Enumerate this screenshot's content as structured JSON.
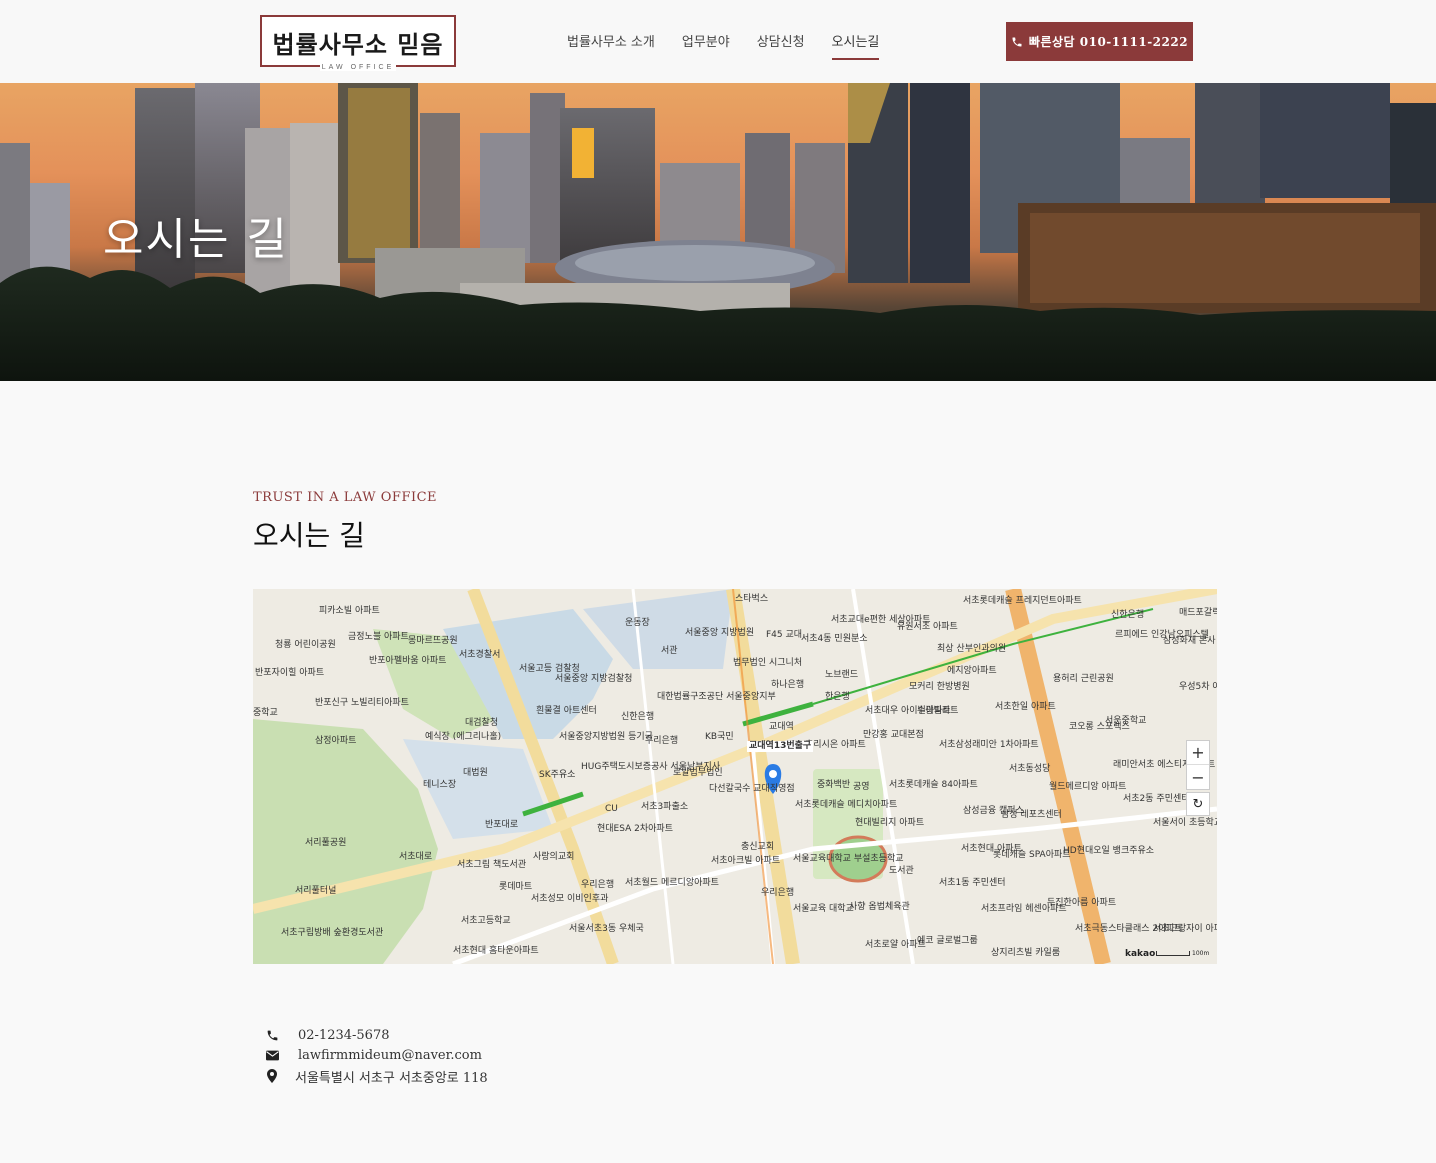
{
  "header": {
    "logo": {
      "title": "법률사무소 믿음",
      "subtitle": "LAW OFFICE"
    },
    "nav": [
      {
        "label": "법률사무소 소개"
      },
      {
        "label": "업무분야"
      },
      {
        "label": "상담신청"
      },
      {
        "label": "오시는길",
        "active": true
      }
    ],
    "cta_label": "빠른상담 010-1111-2222",
    "accent_color": "#8b3a3a"
  },
  "hero": {
    "title": "오시는 길"
  },
  "section": {
    "eyebrow": "TRUST IN A LAW OFFICE",
    "title": "오시는 길"
  },
  "map": {
    "provider": "kakao",
    "scale_label": "100m",
    "center_label": "교대역13번출구",
    "labels": [
      "피카소빌 아파트",
      "금정노블 아파트",
      "몽마르뜨공원",
      "서초경찰서",
      "운동장",
      "서울중앙 지방법원",
      "서관",
      "F45 교대",
      "서초4동 민원분소",
      "서초교대e편한 세상아파트",
      "유원서초 아파트",
      "서초롯데캐슬 프레지던트아파트",
      "신한은행",
      "르피에드 인강남오피스텔",
      "삼성화재 본사",
      "청룡 어린이공원",
      "반포아펠바움 아파트",
      "서울고등 검찰청",
      "서울중앙 지방검찰청",
      "법무법인 시그니처",
      "노브랜드",
      "최상 산부인과의원",
      "에지앙아파트",
      "용허리 근린공원",
      "우성5차 아파트",
      "반포자이힐 아파트",
      "하나은행",
      "한은행",
      "모커리 한방병원",
      "서초한일 아파트",
      "반포신구 노빌리티아파트",
      "대한법률구조공단 서울중앙지부",
      "흰물결 아트센터",
      "신한은행",
      "서초대우 아이빌아파트",
      "수광빌라트",
      "코오롱 스포렉스",
      "서운중학교",
      "중학교",
      "삼정아파트",
      "대검찰청",
      "예식장 (에그리나홀)",
      "서울중앙지방법원 등기국",
      "우리은행",
      "KB국민",
      "교대역",
      "초리시온 아파트",
      "만강홍 교대본점",
      "서초삼성래미안 1차아파트",
      "래미안서초 에스티지아파트",
      "테니스장",
      "대법원",
      "HUG주택도시보증공사 서울남부지사",
      "SK주유소",
      "로얄법무법인",
      "공영",
      "중화백반",
      "서초롯데캐슬 84아파트",
      "서초동성당",
      "월드메르디앙 아파트",
      "서초2동 주민센터",
      "다선칼국수 교대직영점",
      "CU",
      "서초3파출소",
      "서초롯데캐슬 메디치아파트",
      "삼성금융 캠퍼스",
      "삼성 레포츠센터",
      "서울서이 초등학교",
      "서리풀공원",
      "현대ESA 2차아파트",
      "현대빌리지 아파트",
      "사랑의교회",
      "충신교회",
      "서울교육대학교 부설초등학교",
      "도서관",
      "서초현대 아파트",
      "롯데캐슬 SPA아파트",
      "HD현대오일 뱅크주유소",
      "서초그림 책도서관",
      "서초아크빌 아파트",
      "롯데마트",
      "우리은행",
      "서초월드 메르디앙아파트",
      "서초1동 주민센터",
      "서초성모 이비인후과",
      "우리은행",
      "서초프라임 헤센아파트",
      "두진한아름 아파트",
      "서초고등학교",
      "서울교육 대학교",
      "사향 옵법체육관",
      "서초구립방배 숲환경도서관",
      "서울서초3동 우체국",
      "서초로얄 아파트",
      "에코 글로벌그룹",
      "서초극동스타클래스 2아파트",
      "서초그랑자이 아파트",
      "상지리츠빌 카일룸",
      "서초현대 홈타운아파트",
      "서초대로",
      "서리풀터널",
      "반포대로",
      "스타벅스",
      "매드포갈릭"
    ]
  },
  "contact": {
    "phone": "02-1234-5678",
    "email": "lawfirmmideum@naver.com",
    "address": "서울특별시 서초구 서초중앙로 118"
  }
}
